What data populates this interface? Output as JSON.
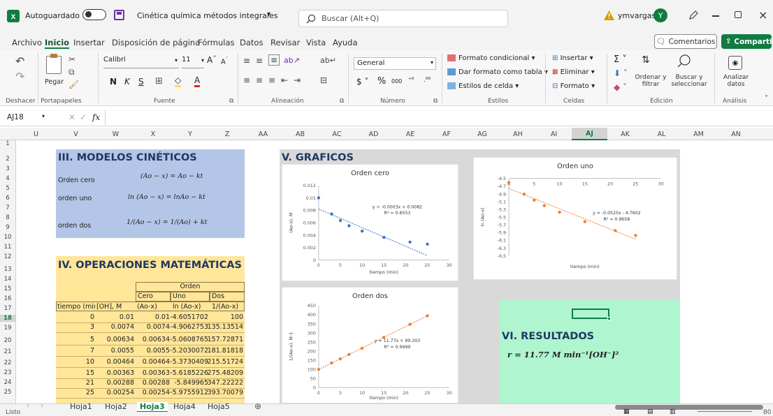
{
  "titlebar": {
    "autosave_label": "Autoguardado",
    "doc_title": "Cinética química métodos integrales",
    "title_caret": "▾",
    "search_placeholder": "Buscar (Alt+Q)",
    "user_name": "ymvargas",
    "avatar_letter": "Y"
  },
  "menu": {
    "tabs": [
      "Archivo",
      "Inicio",
      "Insertar",
      "Disposición de página",
      "Fórmulas",
      "Datos",
      "Revisar",
      "Vista",
      "Ayuda"
    ],
    "comments_label": "Comentarios",
    "share_label": "Compartir"
  },
  "ribbon": {
    "undo_group": "Deshacer",
    "paste_label": "Pegar",
    "clipboard_group": "Portapapeles",
    "font_name": "Calibri",
    "font_size": "11",
    "font_group": "Fuente",
    "align_group": "Alineación",
    "number_format": "General",
    "number_group": "Número",
    "cond_format": "Formato condicional",
    "table_format": "Dar formato como tabla",
    "cell_styles": "Estilos de celda",
    "styles_group": "Estilos",
    "insert_label": "Insertar",
    "delete_label": "Eliminar",
    "format_label": "Formato",
    "cells_group": "Celdas",
    "sort_label": "Ordenar y filtrar",
    "find_label": "Buscar y seleccionar",
    "edit_group": "Edición",
    "analyze_label": "Analizar datos",
    "analysis_group": "Análisis"
  },
  "formula_bar": {
    "name_box": "AJ18",
    "fx": "fx",
    "content": ""
  },
  "columns": [
    "U",
    "V",
    "W",
    "X",
    "Y",
    "Z",
    "AA",
    "AB",
    "AC",
    "AD",
    "AE",
    "AF",
    "AG",
    "AH",
    "AI",
    "AJ",
    "AK",
    "AL",
    "AM",
    "AN"
  ],
  "rows": [
    "1",
    "2",
    "3",
    "4",
    "5",
    "6",
    "7",
    "8",
    "9",
    "10",
    "11",
    "12",
    "13",
    "14",
    "15",
    "16",
    "17",
    "18",
    "19",
    "20",
    "21",
    "22",
    "23",
    "24",
    "25"
  ],
  "sheet": {
    "section3_title": "III. MODELOS CINÉTICOS",
    "models": [
      {
        "label": "Orden cero",
        "equation": "(Ao − x) = Ao − kt"
      },
      {
        "label": "orden uno",
        "equation": "ln (Ao − x) = lnAo − kt"
      },
      {
        "label": "orden dos",
        "equation": "1/(Ao − x) = 1/(Ao) + kt"
      }
    ],
    "section4_title": "IV. OPERACIONES MATEMÁTICAS",
    "section5_title": "V. GRAFICOS",
    "section6_title": "VI. RESULTADOS",
    "result_equation": "r = 11.77 M min⁻¹[OH⁻]²",
    "table": {
      "group_header": "Orden",
      "sub_headers": [
        "Cero",
        "Uno",
        "Dos"
      ],
      "col_headers": [
        "tiempo (min)",
        "[OH], M",
        "(Ao-x)",
        "ln (Ao-x)",
        "1/(Ao-x)"
      ],
      "rows": [
        [
          "0",
          "0.01",
          "0.01",
          "-4.6051702",
          "100"
        ],
        [
          "3",
          "0.0074",
          "0.0074",
          "-4.9062753",
          "135.13514"
        ],
        [
          "5",
          "0.00634",
          "0.00634",
          "-5.0608765",
          "157.72871"
        ],
        [
          "7",
          "0.0055",
          "0.0055",
          "-5.2030072",
          "181.81818"
        ],
        [
          "10",
          "0.00464",
          "0.00464",
          "-5.3730409",
          "215.51724"
        ],
        [
          "15",
          "0.00363",
          "0.00363",
          "-5.6185226",
          "275.48209"
        ],
        [
          "21",
          "0.00288",
          "0.00288",
          "-5.849965",
          "347.22222"
        ],
        [
          "25",
          "0.00254",
          "0.00254",
          "-5.9755912",
          "393.70079"
        ]
      ]
    }
  },
  "chart_data": [
    {
      "type": "scatter",
      "title": "Orden cero",
      "xlabel": "tiempo (min)",
      "ylabel": "(Ao-x), M",
      "x": [
        0,
        3,
        5,
        7,
        10,
        15,
        21,
        25
      ],
      "y": [
        0.01,
        0.0074,
        0.00634,
        0.0055,
        0.00464,
        0.00363,
        0.00288,
        0.00254
      ],
      "xlim": [
        0,
        30
      ],
      "ylim": [
        0,
        0.012
      ],
      "xticks": [
        "0",
        "5",
        "10",
        "15",
        "20",
        "25",
        "30"
      ],
      "yticks": [
        "0",
        "0.002",
        "0.004",
        "0.006",
        "0.008",
        "0.01",
        "0.012"
      ],
      "trendline": {
        "slope": -0.0003,
        "intercept": 0.0082
      },
      "equation": "y = -0.0003x + 0.0082",
      "r2": "R² = 0.8553",
      "color": "#4472c4"
    },
    {
      "type": "scatter",
      "title": "Orden uno",
      "xlabel": "tiempo (min)",
      "ylabel": "ln (Ao-x)",
      "x": [
        0,
        3,
        5,
        7,
        10,
        15,
        21,
        25
      ],
      "y": [
        -4.6051702,
        -4.9062753,
        -5.0608765,
        -5.2030072,
        -5.3730409,
        -5.6185226,
        -5.849965,
        -5.9755912
      ],
      "xlim": [
        0,
        30
      ],
      "ylim": [
        -6.5,
        -4.5
      ],
      "xticks": [
        "0",
        "5",
        "10",
        "15",
        "20",
        "25",
        "30"
      ],
      "yticks": [
        "-4.5",
        "-4.7",
        "-4.9",
        "-5.1",
        "-5.3",
        "-5.5",
        "-5.7",
        "-5.9",
        "-6.1",
        "-6.3",
        "-6.5"
      ],
      "trendline": {
        "slope": -0.0525,
        "intercept": -4.7602
      },
      "equation": "y = -0.0525x - 4.7602",
      "r2": "R² = 0.9658",
      "color": "#ed7d31"
    },
    {
      "type": "scatter",
      "title": "Orden dos",
      "xlabel": "tiempo (min)",
      "ylabel": "1/(Ao-x), M-1",
      "x": [
        0,
        3,
        5,
        7,
        10,
        15,
        21,
        25
      ],
      "y": [
        100,
        135.13514,
        157.72871,
        181.81818,
        215.51724,
        275.48209,
        347.22222,
        393.70079
      ],
      "xlim": [
        0,
        30
      ],
      "ylim": [
        0,
        450
      ],
      "xticks": [
        "0",
        "5",
        "10",
        "15",
        "20",
        "25",
        "30"
      ],
      "yticks": [
        "0",
        "50",
        "100",
        "150",
        "200",
        "250",
        "300",
        "350",
        "400",
        "450"
      ],
      "trendline": {
        "slope": 11.77,
        "intercept": 99.303
      },
      "equation": "y = 11.77x + 99.303",
      "r2": "R² = 0.9999",
      "color": "#ed7d31"
    }
  ],
  "sheet_tabs": [
    "Hoja1",
    "Hoja2",
    "Hoja3",
    "Hoja4",
    "Hoja5"
  ],
  "active_sheet": "Hoja3",
  "status": {
    "ready": "Listo",
    "zoom": "80"
  },
  "colors": {
    "green": "#107c41",
    "blue_block": "#b4c6e7",
    "yellow_block": "#ffe699",
    "mint_block": "#aff5d0",
    "gray_block": "#d9d9d9"
  }
}
